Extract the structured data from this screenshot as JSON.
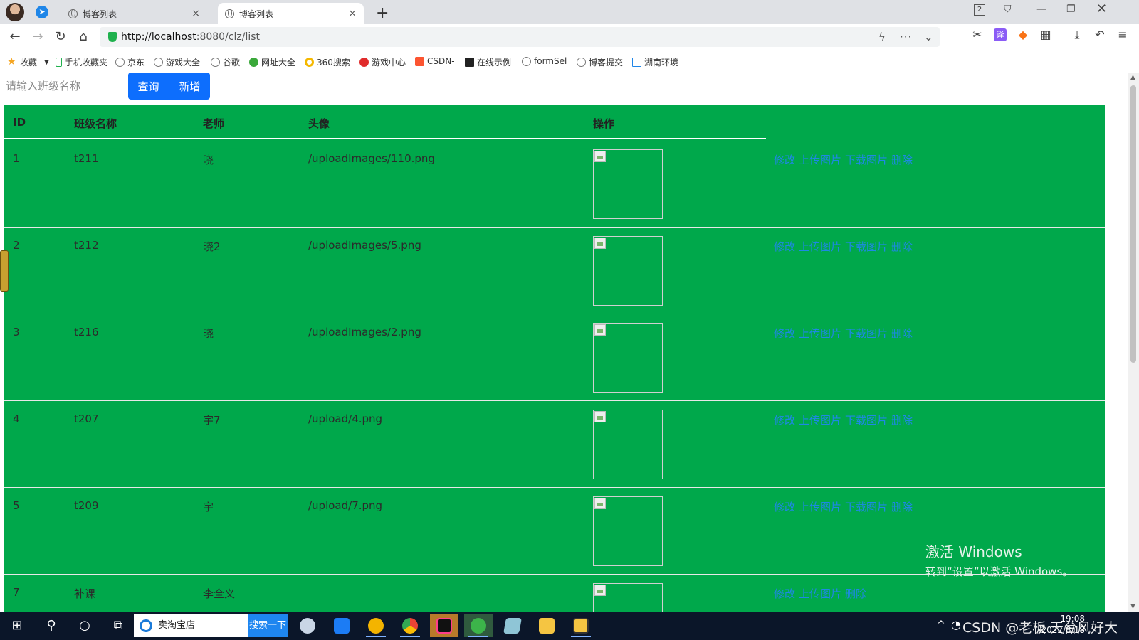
{
  "browser": {
    "tabs": [
      {
        "label": "博客列表",
        "close": "×"
      },
      {
        "label": "博客列表",
        "close": "×"
      }
    ],
    "new_tab": "+",
    "tab_count": "2",
    "url_host": "http://localhost",
    "url_rest": ":8080/clz/list",
    "bookmarks": [
      {
        "label": "收藏",
        "icon": "star-icon"
      },
      {
        "label": "手机收藏夹",
        "icon": "phone-icon"
      },
      {
        "label": "京东",
        "icon": "globe-icon"
      },
      {
        "label": "游戏大全",
        "icon": "globe-icon"
      },
      {
        "label": "谷歌",
        "icon": "globe-icon"
      },
      {
        "label": "网址大全",
        "icon": "green-icon"
      },
      {
        "label": "360搜索",
        "icon": "ring-icon"
      },
      {
        "label": "游戏中心",
        "icon": "red-icon"
      },
      {
        "label": "CSDN-",
        "icon": "csdn-icon"
      },
      {
        "label": "在线示例",
        "icon": "idea-icon"
      },
      {
        "label": "formSel",
        "icon": "globe-icon"
      },
      {
        "label": "博客提交",
        "icon": "globe-icon"
      },
      {
        "label": "湖南环境",
        "icon": "blue-icon"
      }
    ]
  },
  "page": {
    "search_placeholder": "请输入班级名称",
    "query_button": "查询",
    "add_button": "新增",
    "table": {
      "headers": [
        "ID",
        "班级名称",
        "老师",
        "头像",
        "操作"
      ],
      "rows": [
        {
          "id": "1",
          "name": "t211",
          "teacher": "晓",
          "avatar": "/uploadImages/110.png"
        },
        {
          "id": "2",
          "name": "t212",
          "teacher": "晓2",
          "avatar": "/uploadImages/5.png"
        },
        {
          "id": "3",
          "name": "t216",
          "teacher": "晓",
          "avatar": "/uploadImages/2.png"
        },
        {
          "id": "4",
          "name": "t207",
          "teacher": "宇7",
          "avatar": "/upload/4.png"
        },
        {
          "id": "5",
          "name": "t209",
          "teacher": "宇",
          "avatar": "/upload/7.png"
        },
        {
          "id": "7",
          "name": "补课",
          "teacher": "李全义",
          "avatar": ""
        }
      ],
      "actions": {
        "edit": "修改",
        "upload": "上传图片",
        "download": "下载图片",
        "delete": "删除"
      }
    },
    "watermark_line1": "激活 Windows",
    "watermark_line2": "转到“设置”以激活 Windows。"
  },
  "taskbar": {
    "search_text": "卖淘宝店",
    "search_button": "搜索一下",
    "tray_text": "CSDN @老板",
    "tray_text2": "，天台风好大",
    "time": "19:08",
    "date": "2022/8/18"
  }
}
